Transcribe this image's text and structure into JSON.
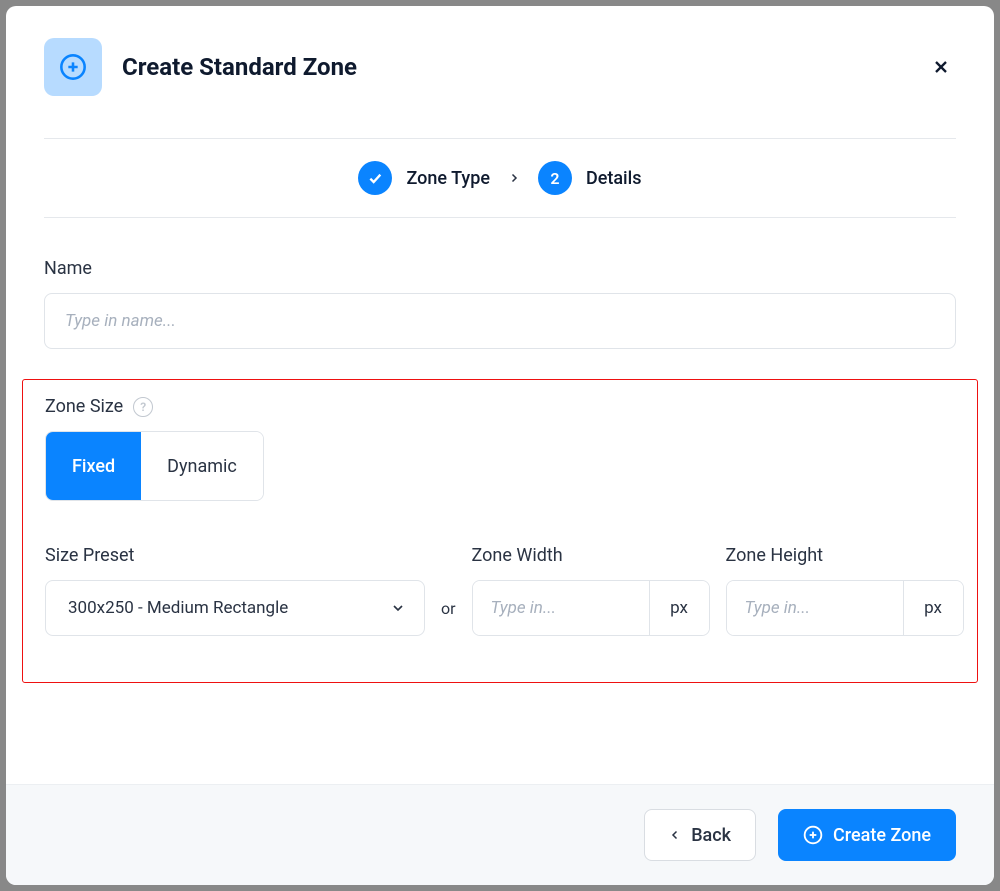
{
  "header": {
    "title": "Create Standard Zone"
  },
  "stepper": {
    "step1": {
      "label": "Zone Type",
      "completed": true
    },
    "step2": {
      "number": "2",
      "label": "Details"
    }
  },
  "form": {
    "name": {
      "label": "Name",
      "placeholder": "Type in name..."
    },
    "zone_size": {
      "label": "Zone Size",
      "options": {
        "fixed": "Fixed",
        "dynamic": "Dynamic"
      },
      "selected": "Fixed"
    },
    "size_preset": {
      "label": "Size Preset",
      "selected": "300x250 - Medium Rectangle"
    },
    "or_text": "or",
    "zone_width": {
      "label": "Zone Width",
      "placeholder": "Type in...",
      "unit": "px"
    },
    "zone_height": {
      "label": "Zone Height",
      "placeholder": "Type in...",
      "unit": "px"
    }
  },
  "footer": {
    "back": "Back",
    "create": "Create Zone"
  },
  "colors": {
    "primary": "#0a84ff",
    "icon_bg": "#b7dbff",
    "highlight": "#e11"
  }
}
